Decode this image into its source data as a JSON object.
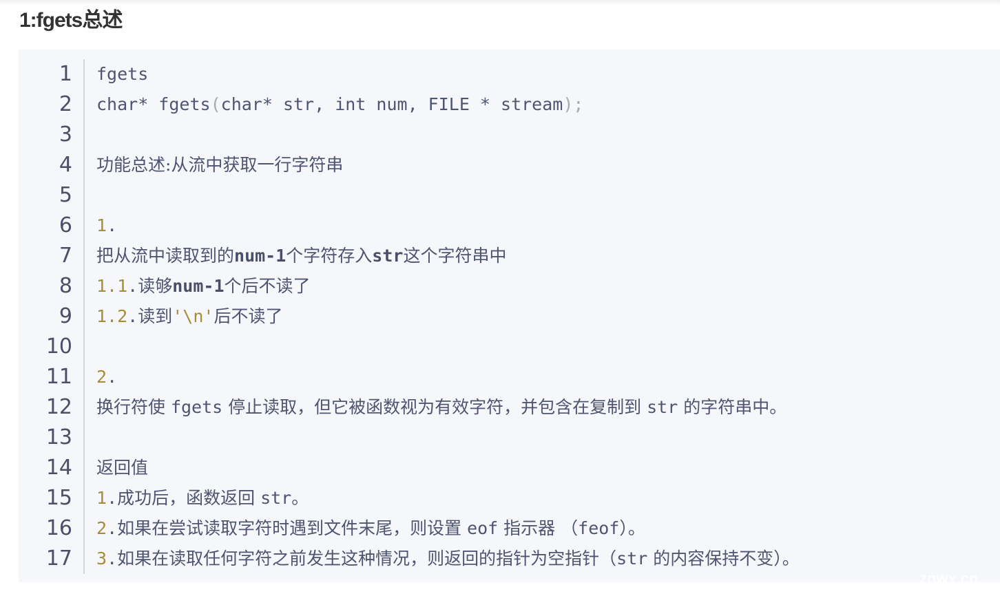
{
  "heading": "1:fgets总述",
  "watermark": "znwx.cn",
  "code_lines": [
    [
      {
        "t": "fgets"
      }
    ],
    [
      {
        "t": "char* fgets"
      },
      {
        "t": "(",
        "c": "punc"
      },
      {
        "t": "char* str, int num, FILE * stream"
      },
      {
        "t": ");",
        "c": "punc"
      }
    ],
    [],
    [
      {
        "t": "功能总述:从流中获取一行字符串",
        "c": "cjk"
      }
    ],
    [],
    [
      {
        "t": "1",
        "c": "num"
      },
      {
        "t": "."
      }
    ],
    [
      {
        "t": "把从流中读取到的",
        "c": "cjk"
      },
      {
        "t": "num-1",
        "c": "bold"
      },
      {
        "t": "个字符存入",
        "c": "cjk"
      },
      {
        "t": "str",
        "c": "bold"
      },
      {
        "t": "这个字符串中",
        "c": "cjk"
      }
    ],
    [
      {
        "t": "1.1",
        "c": "num"
      },
      {
        "t": "."
      },
      {
        "t": "读够",
        "c": "cjk"
      },
      {
        "t": "num-1",
        "c": "bold"
      },
      {
        "t": "个后不读了",
        "c": "cjk"
      }
    ],
    [
      {
        "t": "1.2",
        "c": "num"
      },
      {
        "t": "."
      },
      {
        "t": "读到",
        "c": "cjk"
      },
      {
        "t": "'\\n'",
        "c": "num"
      },
      {
        "t": "后不读了",
        "c": "cjk"
      }
    ],
    [],
    [
      {
        "t": "2",
        "c": "num"
      },
      {
        "t": "."
      }
    ],
    [
      {
        "t": "换行符使 ",
        "c": "cjk"
      },
      {
        "t": "fgets"
      },
      {
        "t": " 停止读取，但它被函数视为有效字符，并包含在复制到 ",
        "c": "cjk"
      },
      {
        "t": "str"
      },
      {
        "t": " 的字符串中。",
        "c": "cjk"
      }
    ],
    [],
    [
      {
        "t": "返回值",
        "c": "cjk"
      }
    ],
    [
      {
        "t": "1",
        "c": "num"
      },
      {
        "t": "."
      },
      {
        "t": "成功后，函数返回 ",
        "c": "cjk"
      },
      {
        "t": "str"
      },
      {
        "t": "。",
        "c": "cjk"
      }
    ],
    [
      {
        "t": "2",
        "c": "num"
      },
      {
        "t": "."
      },
      {
        "t": "如果在尝试读取字符时遇到文件末尾，则设置 ",
        "c": "cjk"
      },
      {
        "t": "eof"
      },
      {
        "t": " 指示器 （",
        "c": "cjk"
      },
      {
        "t": "feof"
      },
      {
        "t": "）。",
        "c": "cjk"
      }
    ],
    [
      {
        "t": "3",
        "c": "num"
      },
      {
        "t": "."
      },
      {
        "t": "如果在读取任何字符之前发生这种情况，则返回的指针为空指针（",
        "c": "cjk"
      },
      {
        "t": "str"
      },
      {
        "t": " 的内容保持不变）。",
        "c": "cjk"
      }
    ]
  ],
  "colors": {
    "number": "#a68d3a",
    "text": "#4f5470",
    "background": "#f6f7fb"
  }
}
